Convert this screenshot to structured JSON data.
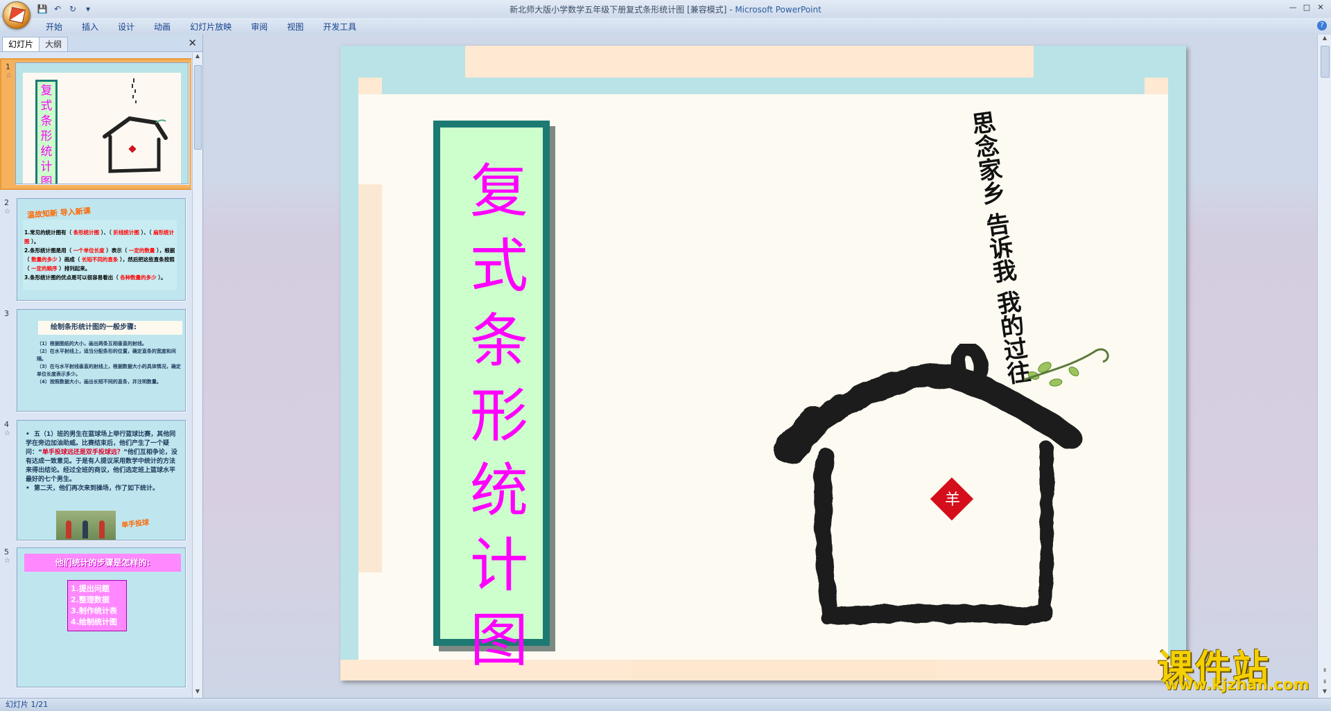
{
  "window": {
    "title_doc": "新北师大版小学数学五年级下册复式条形统计图 [兼容模式]",
    "title_sep": " - ",
    "title_app": "Microsoft PowerPoint"
  },
  "qat": {
    "save": "💾",
    "undo": "↶",
    "redo": "↻",
    "more": "▾"
  },
  "winctl": {
    "min": "—",
    "max": "□",
    "close": "✕"
  },
  "ribbon": {
    "tabs": [
      "开始",
      "插入",
      "设计",
      "动画",
      "幻灯片放映",
      "审阅",
      "视图",
      "开发工具"
    ],
    "help": "?"
  },
  "panel": {
    "tab_slides": "幻灯片",
    "tab_outline": "大纲",
    "close": "✕",
    "slides": [
      {
        "num": "1",
        "title": "复式条形统计图"
      },
      {
        "num": "2",
        "title": "温故知新  导入新课",
        "lines": [
          [
            "1.常见的统计图有（ ",
            "条形统计图",
            " ）、（ ",
            "折线统计图",
            " ）、（ ",
            "扇形统计图",
            " ）。"
          ],
          [
            "2.条形统计图是用（ ",
            "一个单位长度",
            " ）表示（ ",
            "一定的数量",
            " ），根据（ ",
            "数量的多少",
            " ）画成（ ",
            "长短不同的直条",
            " ），然后把这些直条按照（ ",
            "一定的顺序",
            " ）排列起来。"
          ],
          [
            "3.条形统计图的优点是可以很容易看出（ ",
            "各种数量的多少",
            " ）。"
          ]
        ]
      },
      {
        "num": "3",
        "head": "绘制条形统计图的一般步骤:",
        "lines": [
          "（1）根据图纸的大小，画出两条互相垂直的射线。",
          "（2）在水平射线上，适当分配条形的位置，确定直条的宽度和间隔。",
          "（3）在与水平射线垂直的射线上，根据数据大小的具体情况，确定单位长度表示多少。",
          "（4）按照数据大小，画出长短不同的直条，并注明数量。"
        ]
      },
      {
        "num": "4",
        "para1_a": "五（1）班的男生在篮球场上举行篮球比赛，其他同学在旁边加油助威。比赛结束后，他们产生了一个疑问：“",
        "para1_red": "单手投球远还是双手投球远？",
        "para1_b": "”他们互相争论，没有达成一致意见。于是有人提议采用数学中统计的方法来得出结论。经过全班的商议，他们选定班上篮球水平最好的七个男生。",
        "para2": "第二天，他们再次来到操场，作了如下统计。",
        "badge": "单手投球"
      },
      {
        "num": "5",
        "head": "他们统计的步骤是怎样的:",
        "list": [
          "1.提出问题",
          "2.整理数据",
          "3.制作统计表",
          "4.绘制统计图"
        ]
      }
    ]
  },
  "slide": {
    "title_chars": [
      "复",
      "式",
      "条",
      "形",
      "统",
      "计",
      "图"
    ],
    "poem": "思念家乡 告诉我 我的过往"
  },
  "status": {
    "text": "幻灯片 1/21"
  },
  "watermark": {
    "cn": "课件站",
    "url": "www.kjzhan.com"
  }
}
